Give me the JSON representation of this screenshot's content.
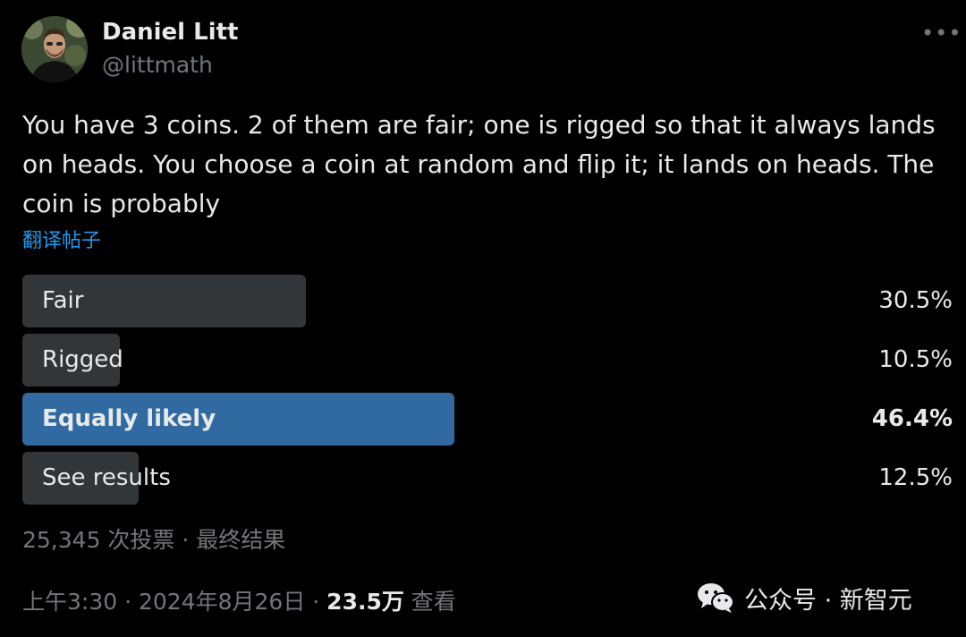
{
  "author": {
    "display_name": "Daniel Litt",
    "handle": "@littmath",
    "avatar_icon": "profile-photo"
  },
  "more_icon": "more-horizontal-icon",
  "tweet": {
    "text": "You have 3 coins. 2 of them are fair; one is rigged so that it always lands on heads. You choose a coin at random and flip it; it lands on heads. The coin is probably",
    "translate_label": "翻译帖子"
  },
  "poll": {
    "options": [
      {
        "label": "Fair",
        "percent_label": "30.5%",
        "percent": 30.5,
        "winner": false
      },
      {
        "label": "Rigged",
        "percent_label": "10.5%",
        "percent": 10.5,
        "winner": false
      },
      {
        "label": "Equally likely",
        "percent_label": "46.4%",
        "percent": 46.4,
        "winner": true
      },
      {
        "label": "See results",
        "percent_label": "12.5%",
        "percent": 12.5,
        "winner": false
      }
    ],
    "summary": "25,345 次投票 · 最终结果"
  },
  "meta": {
    "time_date": "上午3:30 · 2024年8月26日 · ",
    "views": "23.5万",
    "views_suffix": " 查看"
  },
  "watermark": {
    "text": "公众号 · 新智元",
    "icon": "wechat-icon"
  },
  "colors": {
    "background": "#000000",
    "text": "#e7e9ea",
    "secondary_text": "#71767b",
    "link": "#1d9bf0",
    "poll_bar": "#333639",
    "poll_winner_bar": "#306aa1"
  }
}
